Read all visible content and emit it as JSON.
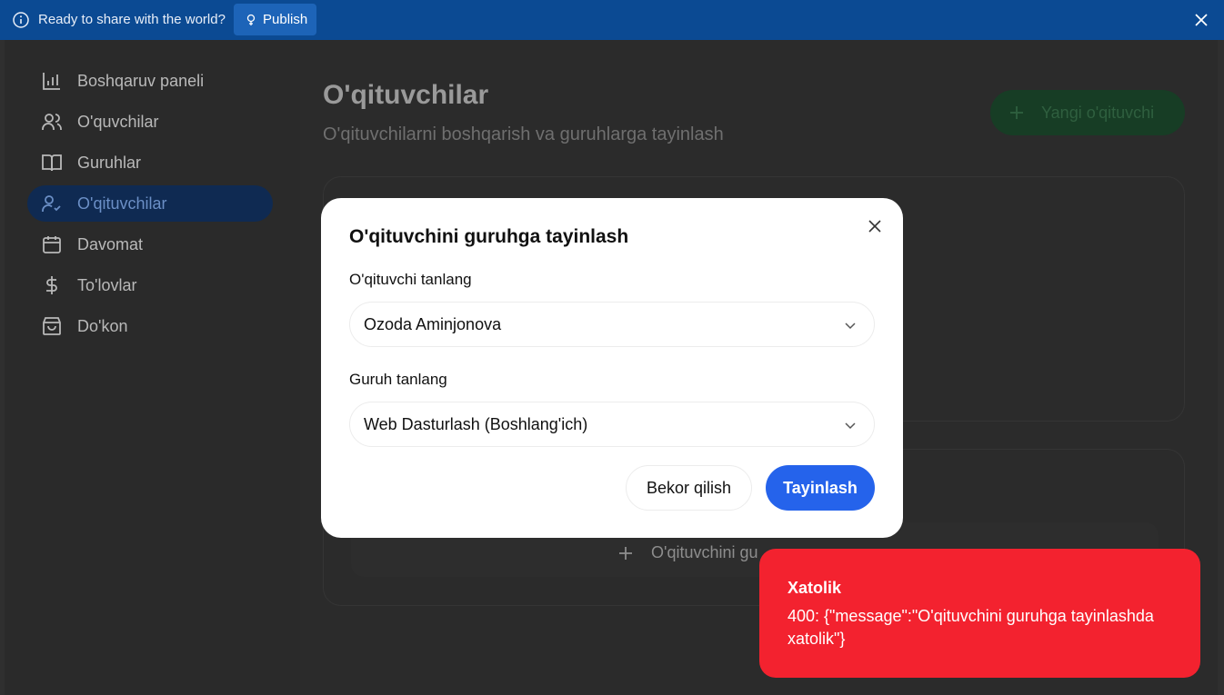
{
  "banner": {
    "text": "Ready to share with the world?",
    "publish_label": "Publish",
    "info_icon": "info-icon",
    "close_icon": "close-icon"
  },
  "sidebar": {
    "items": [
      {
        "label": "Boshqaruv paneli",
        "icon": "bar-chart-icon",
        "active": false
      },
      {
        "label": "O'quvchilar",
        "icon": "users-icon",
        "active": false
      },
      {
        "label": "Guruhlar",
        "icon": "book-icon",
        "active": false
      },
      {
        "label": "O'qituvchilar",
        "icon": "user-check-icon",
        "active": true
      },
      {
        "label": "Davomat",
        "icon": "calendar-icon",
        "active": false
      },
      {
        "label": "To'lovlar",
        "icon": "dollar-icon",
        "active": false
      },
      {
        "label": "Do'kon",
        "icon": "shopping-bag-icon",
        "active": false
      }
    ]
  },
  "page": {
    "title": "O'qituvchilar",
    "subtitle": "O'qituvchilarni boshqarish va guruhlarga tayinlash",
    "new_teacher_label": "Yangi o'qituvchi",
    "assign_teacher_label": "O'qituvchini gu"
  },
  "modal": {
    "title": "O'qituvchini guruhga tayinlash",
    "teacher_label": "O'qituvchi tanlang",
    "teacher_value": "Ozoda Aminjonova",
    "group_label": "Guruh tanlang",
    "group_value": "Web Dasturlash (Boshlang'ich)",
    "cancel_label": "Bekor qilish",
    "assign_label": "Tayinlash"
  },
  "toast": {
    "title": "Xatolik",
    "message": "400: {\"message\":\"O'qituvchini guruhga tayinlashda xatolik\"}"
  },
  "colors": {
    "banner": "#0b4a93",
    "primary": "#2563eb",
    "error": "#f3222f"
  }
}
